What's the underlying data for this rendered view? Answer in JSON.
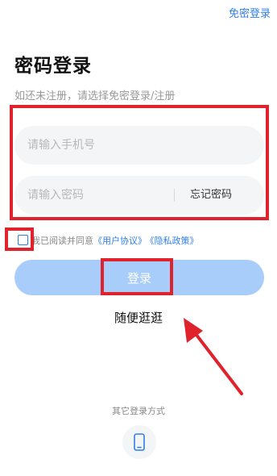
{
  "header": {
    "top_link": "免密登录"
  },
  "title": "密码登录",
  "subtitle": "如还未注册，请选择免密登录/注册",
  "form": {
    "phone_placeholder": "请输入手机号",
    "password_placeholder": "请输入密码",
    "forgot_password": "忘记密码"
  },
  "agreement": {
    "prefix": "我已阅读并同意",
    "user_agreement": "《用户协议》",
    "privacy_policy": "《隐私政策》"
  },
  "login_button": "登录",
  "browse_link": "随便逛逛",
  "other_methods": {
    "label": "其它登录方式",
    "phone_icon": "phone-icon"
  },
  "colors": {
    "accent": "#2f7ee8",
    "login_button_disabled": "#a9cdfa",
    "annotation_red": "#e0222d"
  }
}
